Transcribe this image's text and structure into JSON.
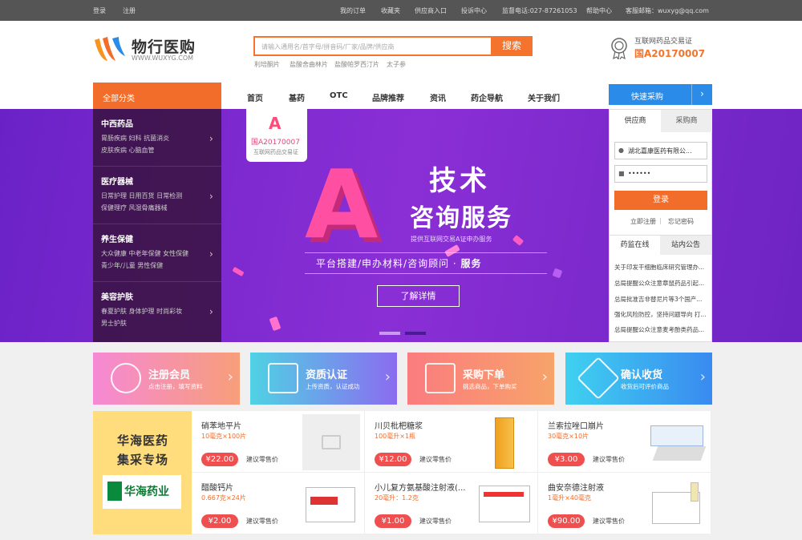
{
  "topbar": {
    "login": "登录",
    "register": "注册",
    "orders": "我的订单",
    "favorites": "收藏夹",
    "supplier": "供应商入口",
    "complaint": "投诉中心",
    "hotline": "监督电话:027-87261053",
    "help": "帮助中心",
    "email": "客服邮箱：wuxyg@qq.com"
  },
  "logo": {
    "name": "物行医购",
    "site": "WWW.WUXYG.COM"
  },
  "search": {
    "placeholder": "请输入通用名/首字母/拼音码/厂家/品牌/供应商",
    "button": "搜索",
    "hot": [
      "利培酮片",
      "盐酸舍曲林片",
      "盐酸帕罗西汀片",
      "太子参"
    ]
  },
  "license": {
    "label": "互联网药品交易证",
    "number": "国A20170007"
  },
  "nav": {
    "all": "全部分类",
    "items": [
      "首页",
      "基药",
      "OTC",
      "品牌推荐",
      "资讯",
      "药企导航",
      "关于我们"
    ],
    "quick": "快速采购",
    "quick_arrow": "›"
  },
  "categories": [
    {
      "title": "中西药品",
      "line1": "胃肠疾病  妇科  抗菌消炎",
      "line2": "皮肤疾病  心脑血管"
    },
    {
      "title": "医疗器械",
      "line1": "日常护理  日用百货  日常检测",
      "line2": "保健理疗  风湿骨痛器械"
    },
    {
      "title": "养生保健",
      "line1": "大众健康  中老年保健  女性保健",
      "line2": "青少年/儿童  男性保健"
    },
    {
      "title": "美容护肤",
      "line1": "春夏护肤  身体护理  时尚彩妆",
      "line2": "男士护肤"
    }
  ],
  "banner": {
    "flag_letter": "A",
    "flag_number": "国A20170007",
    "flag_label": "互联网药品交易证",
    "big_letter": "A",
    "title1": "技术",
    "title2": "咨询服务",
    "subtitle": "提供互联网交易A证申办服务",
    "line": "平台搭建/申办材料/咨询顾问 · ",
    "line_bold": "服务",
    "detail": "了解详情"
  },
  "login": {
    "tab_supplier": "供应商",
    "tab_buyer": "采购商",
    "user_icon": "user-icon",
    "user": "湖北嘉康医药有限公...",
    "pwd_icon": "lock-icon",
    "password": "••••••",
    "submit": "登录",
    "register": "立即注册",
    "forgot": "忘记密码"
  },
  "news": {
    "tab1": "药监在线",
    "tab2": "站内公告",
    "items": [
      "关于印发干细胞临床研究管理办...",
      "总局提醒公众注意章鼠药品引起...",
      "总局批准吉非替尼片等3个国产...",
      "强化风险防控，坚持问题导向 打...",
      "总局提醒公众注意麦考酚类药品..."
    ]
  },
  "features": [
    {
      "title": "注册会员",
      "sub": "点击注册，填写资料",
      "color1": "#f68bd3",
      "color2": "#f7a07a"
    },
    {
      "title": "资质认证",
      "sub": "上传资质，认证成功",
      "color1": "#4fd2e4",
      "color2": "#8b6cf0"
    },
    {
      "title": "采购下单",
      "sub": "挑选商品，下单购买",
      "color1": "#fb7c7f",
      "color2": "#f7a36a"
    },
    {
      "title": "确认收货",
      "sub": "收货后可评价商品",
      "color1": "#3fd1f0",
      "color2": "#3a8af0"
    }
  ],
  "promo": {
    "line1": "华海医药",
    "line2": "集采专场",
    "brand": "华海药业"
  },
  "products": [
    {
      "name": "硝苯地平片",
      "spec": "10毫克×100片",
      "price": "¥22.00",
      "retail": "建议零售价"
    },
    {
      "name": "川贝枇杷糖浆",
      "spec": "100毫升×1瓶",
      "price": "¥12.00",
      "retail": "建议零售价"
    },
    {
      "name": "兰索拉唑口崩片",
      "spec": "30毫克×10片",
      "price": "¥3.00",
      "retail": "建议零售价"
    },
    {
      "name": "醋酸钙片",
      "spec": "0.667克×24片",
      "price": "¥2.00",
      "retail": "建议零售价"
    },
    {
      "name": "小儿复方氨基酸注射液(...",
      "spec": "20毫升：1.2克",
      "price": "¥1.00",
      "retail": "建议零售价"
    },
    {
      "name": "曲安奈德注射液",
      "spec": "1毫升×40毫克",
      "price": "¥90.00",
      "retail": "建议零售价"
    }
  ]
}
